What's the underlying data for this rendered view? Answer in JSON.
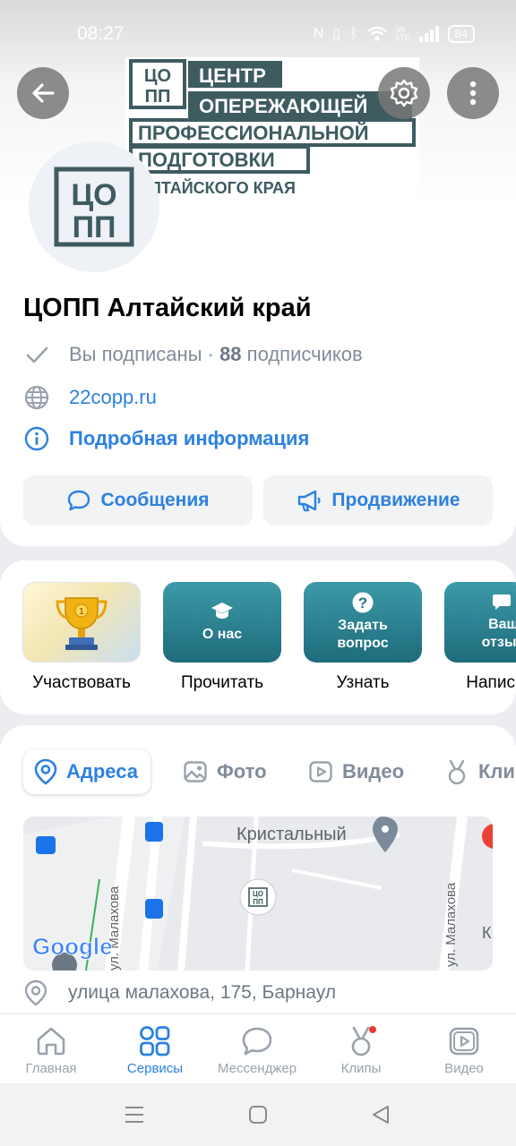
{
  "status_bar": {
    "time": "08:27",
    "battery": "84"
  },
  "cover": {
    "logo_lines": [
      "ЦЕНТР",
      "ОПЕРЕЖАЮЩЕЙ",
      "ПРОФЕССИОНАЛЬНОЙ",
      "ПОДГОТОВКИ",
      "АЛТАЙСКОГО КРАЯ"
    ],
    "logo_mark": "ЦОПП"
  },
  "group": {
    "title": "ЦОПП Алтайский край",
    "subscribed_text": "Вы подписаны",
    "separator": " · ",
    "subscribers_count": "88",
    "subscribers_label": " подписчиков",
    "website": "22copp.ru",
    "details_link": "Подробная информация"
  },
  "actions": {
    "messages": "Сообщения",
    "promotion": "Продвижение"
  },
  "widgets": [
    {
      "tile_text": "",
      "label": "Участвовать"
    },
    {
      "tile_text": "О нас",
      "label": "Прочитать"
    },
    {
      "tile_text": "Задать вопрос",
      "label": "Узнать"
    },
    {
      "tile_text": "Ваш отзыв",
      "label": "Написать"
    }
  ],
  "tabs": {
    "addresses": "Адреса",
    "photos": "Фото",
    "videos": "Видео",
    "clips": "Клипы"
  },
  "map": {
    "place_label": "Кристальный",
    "street_label": "ул. Малахова",
    "street_label_2": "ул. Малахова",
    "edge_letter": "К",
    "provider": "Google"
  },
  "address": "улица малахова, 175, Барнаул",
  "bottom_nav": {
    "home": "Главная",
    "services": "Сервисы",
    "messenger": "Мессенджер",
    "clips": "Клипы",
    "video": "Видео"
  },
  "colors": {
    "accent": "#2d81e0",
    "teal": "#1e6b7b",
    "logo": "#3e5b60"
  }
}
